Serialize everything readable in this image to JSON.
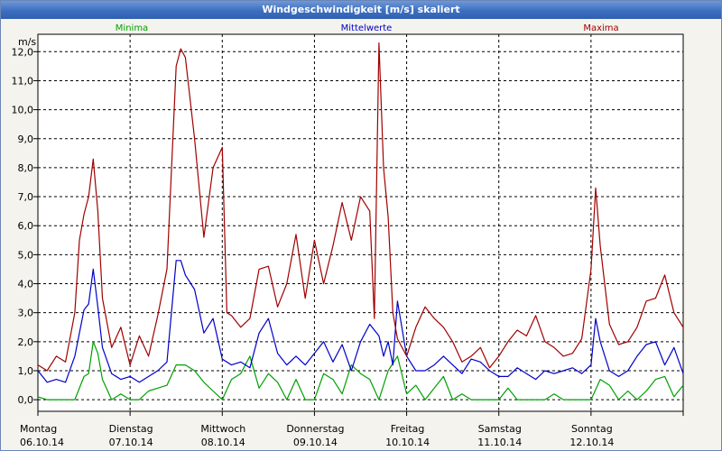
{
  "window": {
    "title": "Windgeschwindigkeit [m/s] skaliert"
  },
  "chart_data": {
    "type": "line",
    "title": "Windgeschwindigkeit [m/s] skaliert",
    "ylabel": "m/s",
    "ylim": [
      -0.4,
      12.6
    ],
    "xlim": [
      0,
      7
    ],
    "yticks": [
      "0,0",
      "1,0",
      "2,0",
      "3,0",
      "4,0",
      "5,0",
      "6,0",
      "7,0",
      "8,0",
      "9,0",
      "10,0",
      "11,0",
      "12,0"
    ],
    "xticks": [
      {
        "day": "Montag",
        "date": "06.10.14"
      },
      {
        "day": "Dienstag",
        "date": "07.10.14"
      },
      {
        "day": "Mittwoch",
        "date": "08.10.14"
      },
      {
        "day": "Donnerstag",
        "date": "09.10.14"
      },
      {
        "day": "Freitag",
        "date": "10.10.14"
      },
      {
        "day": "Samstag",
        "date": "11.10.14"
      },
      {
        "day": "Sonntag",
        "date": "12.10.14"
      }
    ],
    "grid": true,
    "legend_position": "top",
    "series": [
      {
        "name": "Minima",
        "color": "#00a000",
        "x": [
          0,
          0.1,
          0.2,
          0.3,
          0.4,
          0.5,
          0.55,
          0.6,
          0.65,
          0.7,
          0.8,
          0.9,
          1.0,
          1.1,
          1.2,
          1.3,
          1.4,
          1.5,
          1.6,
          1.7,
          1.8,
          1.9,
          2.0,
          2.1,
          2.2,
          2.3,
          2.4,
          2.5,
          2.6,
          2.7,
          2.8,
          2.9,
          3.0,
          3.1,
          3.2,
          3.3,
          3.4,
          3.5,
          3.6,
          3.7,
          3.8,
          3.9,
          4.0,
          4.1,
          4.2,
          4.3,
          4.4,
          4.5,
          4.6,
          4.7,
          4.8,
          4.9,
          5.0,
          5.1,
          5.2,
          5.3,
          5.4,
          5.5,
          5.6,
          5.7,
          5.8,
          5.9,
          6.0,
          6.1,
          6.2,
          6.3,
          6.4,
          6.5,
          6.6,
          6.7,
          6.8,
          6.9,
          7.0
        ],
        "y": [
          0.1,
          0.0,
          0.0,
          0.0,
          0.0,
          0.8,
          0.9,
          2.0,
          1.6,
          0.7,
          0.0,
          0.2,
          0.0,
          0.0,
          0.3,
          0.4,
          0.5,
          1.2,
          1.2,
          1.0,
          0.6,
          0.3,
          0.0,
          0.7,
          0.9,
          1.5,
          0.4,
          0.9,
          0.6,
          0.0,
          0.7,
          0.0,
          0.0,
          0.9,
          0.7,
          0.2,
          1.2,
          0.9,
          0.7,
          0.0,
          1.0,
          1.5,
          0.2,
          0.5,
          0.0,
          0.4,
          0.8,
          0.0,
          0.2,
          0.0,
          0.0,
          0.0,
          0.0,
          0.4,
          0.0,
          0.0,
          0.0,
          0.0,
          0.2,
          0.0,
          0.0,
          0.0,
          0.0,
          0.7,
          0.5,
          0.0,
          0.3,
          0.0,
          0.3,
          0.7,
          0.8,
          0.1,
          0.5
        ]
      },
      {
        "name": "Mittelwerte",
        "color": "#0000c8",
        "x": [
          0,
          0.1,
          0.2,
          0.3,
          0.4,
          0.5,
          0.55,
          0.6,
          0.65,
          0.7,
          0.8,
          0.9,
          1.0,
          1.1,
          1.2,
          1.3,
          1.4,
          1.5,
          1.55,
          1.6,
          1.7,
          1.8,
          1.9,
          2.0,
          2.1,
          2.2,
          2.3,
          2.4,
          2.5,
          2.6,
          2.7,
          2.8,
          2.9,
          3.0,
          3.1,
          3.2,
          3.3,
          3.4,
          3.5,
          3.6,
          3.7,
          3.75,
          3.8,
          3.85,
          3.9,
          4.0,
          4.1,
          4.2,
          4.3,
          4.4,
          4.5,
          4.6,
          4.7,
          4.8,
          4.9,
          5.0,
          5.1,
          5.2,
          5.3,
          5.4,
          5.5,
          5.6,
          5.7,
          5.8,
          5.9,
          6.0,
          6.05,
          6.1,
          6.2,
          6.3,
          6.4,
          6.5,
          6.6,
          6.7,
          6.8,
          6.9,
          7.0
        ],
        "y": [
          1.0,
          0.6,
          0.7,
          0.6,
          1.5,
          3.1,
          3.3,
          4.5,
          3.2,
          1.8,
          0.9,
          0.7,
          0.8,
          0.6,
          0.8,
          1.0,
          1.3,
          4.8,
          4.8,
          4.3,
          3.8,
          2.3,
          2.8,
          1.4,
          1.2,
          1.3,
          1.1,
          2.3,
          2.8,
          1.6,
          1.2,
          1.5,
          1.2,
          1.6,
          2.0,
          1.3,
          1.9,
          1.0,
          2.0,
          2.6,
          2.2,
          1.5,
          2.0,
          1.2,
          3.4,
          1.5,
          1.0,
          1.0,
          1.2,
          1.5,
          1.2,
          0.9,
          1.4,
          1.3,
          1.0,
          0.8,
          0.8,
          1.1,
          0.9,
          0.7,
          1.0,
          0.9,
          1.0,
          1.1,
          0.9,
          1.2,
          2.8,
          2.0,
          1.0,
          0.8,
          1.0,
          1.5,
          1.9,
          2.0,
          1.2,
          1.8,
          0.9
        ]
      },
      {
        "name": "Maxima",
        "color": "#a00000",
        "x": [
          0,
          0.1,
          0.2,
          0.3,
          0.4,
          0.45,
          0.5,
          0.55,
          0.6,
          0.65,
          0.7,
          0.8,
          0.9,
          1.0,
          1.1,
          1.2,
          1.3,
          1.4,
          1.5,
          1.55,
          1.6,
          1.7,
          1.8,
          1.9,
          2.0,
          2.05,
          2.1,
          2.2,
          2.3,
          2.4,
          2.5,
          2.6,
          2.7,
          2.8,
          2.9,
          3.0,
          3.1,
          3.2,
          3.3,
          3.4,
          3.5,
          3.6,
          3.65,
          3.7,
          3.75,
          3.8,
          3.85,
          3.9,
          4.0,
          4.1,
          4.2,
          4.3,
          4.4,
          4.5,
          4.6,
          4.7,
          4.8,
          4.9,
          5.0,
          5.1,
          5.2,
          5.3,
          5.4,
          5.5,
          5.6,
          5.7,
          5.8,
          5.9,
          6.0,
          6.05,
          6.1,
          6.2,
          6.3,
          6.4,
          6.5,
          6.6,
          6.7,
          6.8,
          6.9,
          7.0
        ],
        "y": [
          1.2,
          1.0,
          1.5,
          1.3,
          3.0,
          5.5,
          6.4,
          7.0,
          8.3,
          6.5,
          3.5,
          1.8,
          2.5,
          1.2,
          2.2,
          1.5,
          2.9,
          4.5,
          11.5,
          12.1,
          11.8,
          9.0,
          5.6,
          8.0,
          8.7,
          3.0,
          2.9,
          2.5,
          2.8,
          4.5,
          4.6,
          3.2,
          4.0,
          5.7,
          3.5,
          5.5,
          4.0,
          5.3,
          6.8,
          5.5,
          7.0,
          6.5,
          2.8,
          12.3,
          8.0,
          6.3,
          3.0,
          2.1,
          1.5,
          2.5,
          3.2,
          2.8,
          2.5,
          2.0,
          1.3,
          1.5,
          1.8,
          1.1,
          1.5,
          2.0,
          2.4,
          2.2,
          2.9,
          2.0,
          1.8,
          1.5,
          1.6,
          2.1,
          4.5,
          7.3,
          5.3,
          2.6,
          1.9,
          2.0,
          2.5,
          3.4,
          3.5,
          4.3,
          3.0,
          2.5
        ]
      }
    ]
  }
}
